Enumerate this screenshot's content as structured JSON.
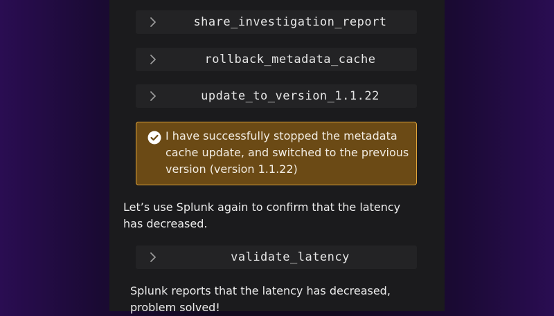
{
  "tools": [
    {
      "name": "share_investigation_report"
    },
    {
      "name": "rollback_metadata_cache"
    },
    {
      "name": "update_to_version_1.1.22"
    },
    {
      "name": "validate_latency"
    }
  ],
  "success_message": "I have successfully stopped the metadata cache update, and switched to the previous version (version 1.1.22)",
  "paragraph_1": "Let’s use Splunk again to confirm that the latency has decreased.",
  "paragraph_2": "Splunk reports that the latency has decreased, problem solved!",
  "colors": {
    "success_border": "#e0a43a",
    "success_fill": "#6b4a15",
    "panel": "#1b1b1d",
    "tool_row": "#232325"
  },
  "icons": [
    "chevron-right-icon",
    "check-circle-icon"
  ]
}
